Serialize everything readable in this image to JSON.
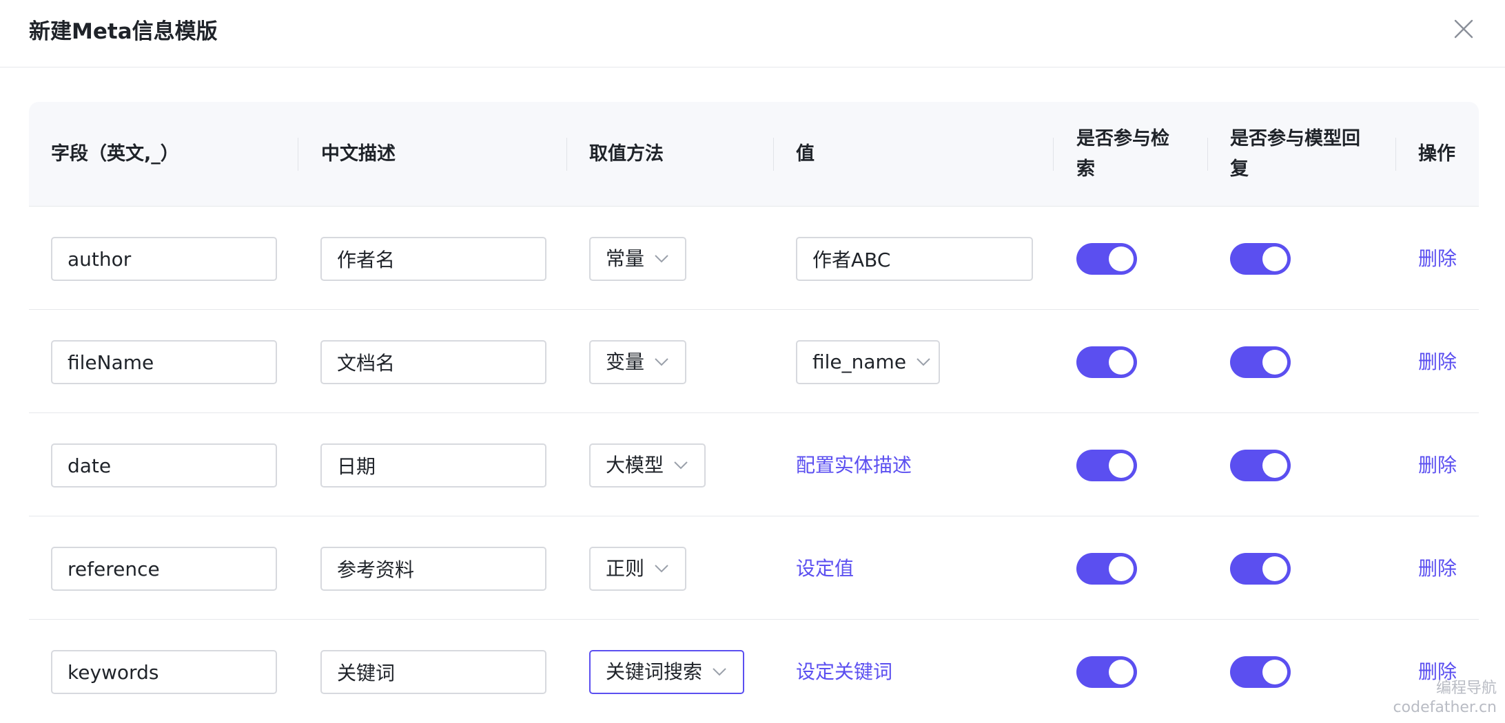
{
  "dialog": {
    "title": "新建Meta信息模版"
  },
  "table": {
    "headers": {
      "field": "字段（英文,_）",
      "desc": "中文描述",
      "method": "取值方法",
      "value": "值",
      "search_l1": "是否参与检",
      "search_l2": "索",
      "reply_l1": "是否参与模型回",
      "reply_l2": "复",
      "action": "操作"
    },
    "rows": [
      {
        "field": "author",
        "desc": "作者名",
        "method": "常量",
        "value": "作者ABC",
        "action": "删除"
      },
      {
        "field": "fileName",
        "desc": "文档名",
        "method": "变量",
        "value": "file_name",
        "action": "删除"
      },
      {
        "field": "date",
        "desc": "日期",
        "method": "大模型",
        "value": "配置实体描述",
        "action": "删除"
      },
      {
        "field": "reference",
        "desc": "参考资料",
        "method": "正则",
        "value": "设定值",
        "action": "删除"
      },
      {
        "field": "keywords",
        "desc": "关键词",
        "method": "关键词搜索",
        "value": "设定关键词",
        "action": "删除"
      }
    ]
  },
  "watermark": {
    "line1": "编程导航",
    "line2": "codefather.cn"
  },
  "colors": {
    "accent": "#5b4ff0",
    "border": "#d7d9de",
    "header_bg": "#f7f8fb"
  },
  "icons": {
    "close": "close-icon",
    "dropdown": "chevron-down-icon"
  }
}
